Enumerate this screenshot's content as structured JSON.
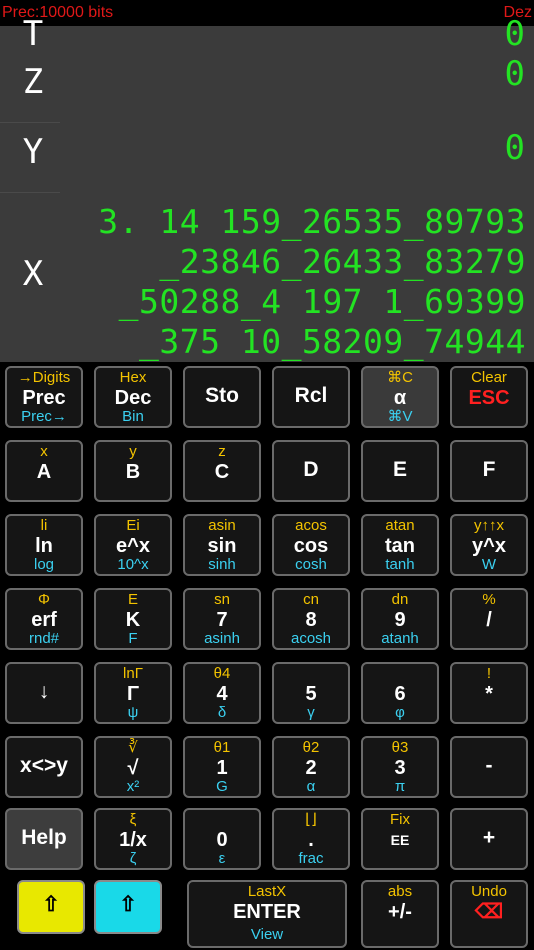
{
  "status": {
    "left": "Prec:10000 bits",
    "right": "Dez"
  },
  "stack": {
    "t_label": "T",
    "t_value": "0",
    "z_label": "Z",
    "z_value": "0",
    "y_label": "Y",
    "y_value": "0",
    "x_label": "X",
    "x_lines": [
      "3. 14 159_26535_89793",
      "_23846_26433_83279",
      "_50288_4 197 1_69399",
      "_375 10_58209_74944"
    ]
  },
  "keys": {
    "prec": {
      "top": "→Digits",
      "mid": "Prec",
      "bot": "Prec→"
    },
    "dec": {
      "top": "Hex",
      "mid": "Dec",
      "bot": "Bin"
    },
    "sto": {
      "mid": "Sto"
    },
    "rcl": {
      "mid": "Rcl"
    },
    "alpha": {
      "top": "⌘C",
      "mid": "α",
      "bot": "⌘V"
    },
    "esc": {
      "top": "Clear",
      "mid": "ESC"
    },
    "a": {
      "top": "x",
      "mid": "A"
    },
    "b": {
      "top": "y",
      "mid": "B"
    },
    "c": {
      "top": "z",
      "mid": "C"
    },
    "d": {
      "mid": "D"
    },
    "e": {
      "mid": "E"
    },
    "f": {
      "mid": "F"
    },
    "ln": {
      "top": "li",
      "mid": "ln",
      "bot": "log"
    },
    "exp": {
      "top": "Ei",
      "mid": "e^x",
      "bot": "10^x"
    },
    "sin": {
      "top": "asin",
      "mid": "sin",
      "bot": "sinh"
    },
    "cos": {
      "top": "acos",
      "mid": "cos",
      "bot": "cosh"
    },
    "tan": {
      "top": "atan",
      "mid": "tan",
      "bot": "tanh"
    },
    "pow": {
      "top": "y↑↑x",
      "mid": "y^x",
      "bot": "W"
    },
    "erf": {
      "top": "Φ",
      "mid": "erf",
      "bot": "rnd#"
    },
    "k": {
      "top": "E",
      "mid": "K",
      "bot": "F"
    },
    "n7": {
      "top": "sn",
      "mid": "7",
      "bot": "asinh"
    },
    "n8": {
      "top": "cn",
      "mid": "8",
      "bot": "acosh"
    },
    "n9": {
      "top": "dn",
      "mid": "9",
      "bot": "atanh"
    },
    "div": {
      "top": "%",
      "mid": "/"
    },
    "down": {
      "mid": "↓"
    },
    "gamma": {
      "top": "lnΓ",
      "mid": "Γ",
      "bot": "ψ"
    },
    "n4": {
      "top": "θ4",
      "mid": "4",
      "bot": "δ"
    },
    "n5": {
      "mid": "5",
      "bot": "γ"
    },
    "n6": {
      "mid": "6",
      "bot": "φ"
    },
    "mul": {
      "top": "!",
      "mid": "*"
    },
    "swap": {
      "mid": "x<>y"
    },
    "sqrt": {
      "top": "∛",
      "mid": "√",
      "bot": "x²"
    },
    "n1": {
      "top": "θ1",
      "mid": "1",
      "bot": "G"
    },
    "n2": {
      "top": "θ2",
      "mid": "2",
      "bot": "α"
    },
    "n3": {
      "top": "θ3",
      "mid": "3",
      "bot": "π"
    },
    "minus": {
      "mid": "-"
    },
    "help": {
      "mid": "Help"
    },
    "inv": {
      "top": "ξ",
      "mid": "1/x",
      "bot": "ζ"
    },
    "n0": {
      "mid": "0",
      "bot": "ε"
    },
    "dot": {
      "top": "⌊⌋",
      "mid": ".",
      "bot": "frac"
    },
    "ee": {
      "top": "Fix",
      "mid": "EE"
    },
    "plus": {
      "mid": "+"
    },
    "shift_yellow": {
      "mid": "⇧"
    },
    "shift_cyan": {
      "mid": "⇧"
    },
    "enter": {
      "top": "LastX",
      "mid": "ENTER",
      "bot": "View"
    },
    "chs": {
      "top": "abs",
      "mid": "+/-"
    },
    "undo": {
      "top": "Undo",
      "mid": "⌫"
    }
  },
  "colors": {
    "display_bg": "#3b3b3b",
    "display_fg": "#23e323",
    "shift_yellow": "#e8e800",
    "shift_cyan": "#19d9e8",
    "status": "#e01818"
  }
}
